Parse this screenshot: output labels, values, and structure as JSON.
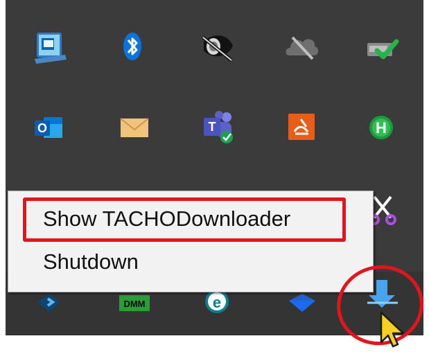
{
  "context_menu": {
    "items": [
      {
        "label": "Show TACHODownloader"
      },
      {
        "label": "Shutdown"
      }
    ]
  },
  "icons": {
    "row1": [
      "intel-graphics-icon",
      "bluetooth-icon",
      "speaker-muted-icon",
      "cloud-offline-icon",
      "drive-check-icon"
    ],
    "row2": [
      "outlook-icon",
      "mail-envelope-icon",
      "teams-icon",
      "presentation-app-icon",
      "green-h-icon"
    ],
    "row3": [
      "snipping-tool-icon"
    ],
    "row4": [
      "network-arrow-icon",
      "dmm-icon",
      "edge-icon",
      "down-arrow-icon",
      "tachodownloader-icon"
    ]
  },
  "annotations": {
    "highlight_color": "#e2141e"
  },
  "colors": {
    "tray_background": "#3b3b3b",
    "menu_background": "#f2f2f2"
  }
}
